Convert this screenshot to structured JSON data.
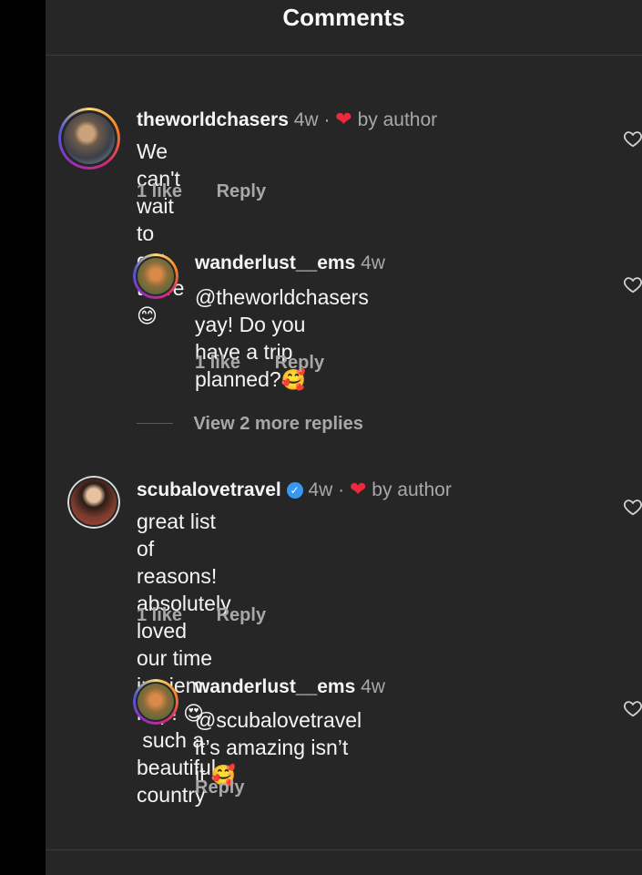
{
  "header": {
    "title": "Comments"
  },
  "comments": [
    {
      "username": "theworldchasers",
      "time": "4w",
      "separator": "·",
      "author_like": "by author",
      "text": "We can't wait to get there",
      "text_emoji": "😊",
      "likes": "1 like",
      "reply": "Reply"
    },
    {
      "username": "wanderlust__ems",
      "time": "4w",
      "text_line1": "@theworldchasers yay! Do you",
      "text_line2": "have a trip planned?",
      "text_emoji": "🥰",
      "likes": "1 like",
      "reply": "Reply"
    },
    {
      "view_more": "View 2 more replies"
    },
    {
      "username": "scubalovetravel",
      "verified_icon": "verified-badge-icon",
      "time": "4w",
      "separator": "·",
      "author_like": "by author",
      "text_line1": "great list of reasons!  absolutely loved",
      "text_line2a": "our time in siem riep!",
      "text_emoji": "😍",
      "text_line2b": "such a beautiful",
      "text_line3": "country",
      "likes": "1 like",
      "reply": "Reply"
    },
    {
      "username": "wanderlust__ems",
      "time": "4w",
      "text_line1": "@scubalovetravel it’s amazing isn’t",
      "text_line2": "it",
      "text_emoji": "🥰",
      "reply": "Reply"
    }
  ],
  "colors": {
    "background": "#262626",
    "heart": "#ed2a3c",
    "verified": "#3897f0"
  }
}
